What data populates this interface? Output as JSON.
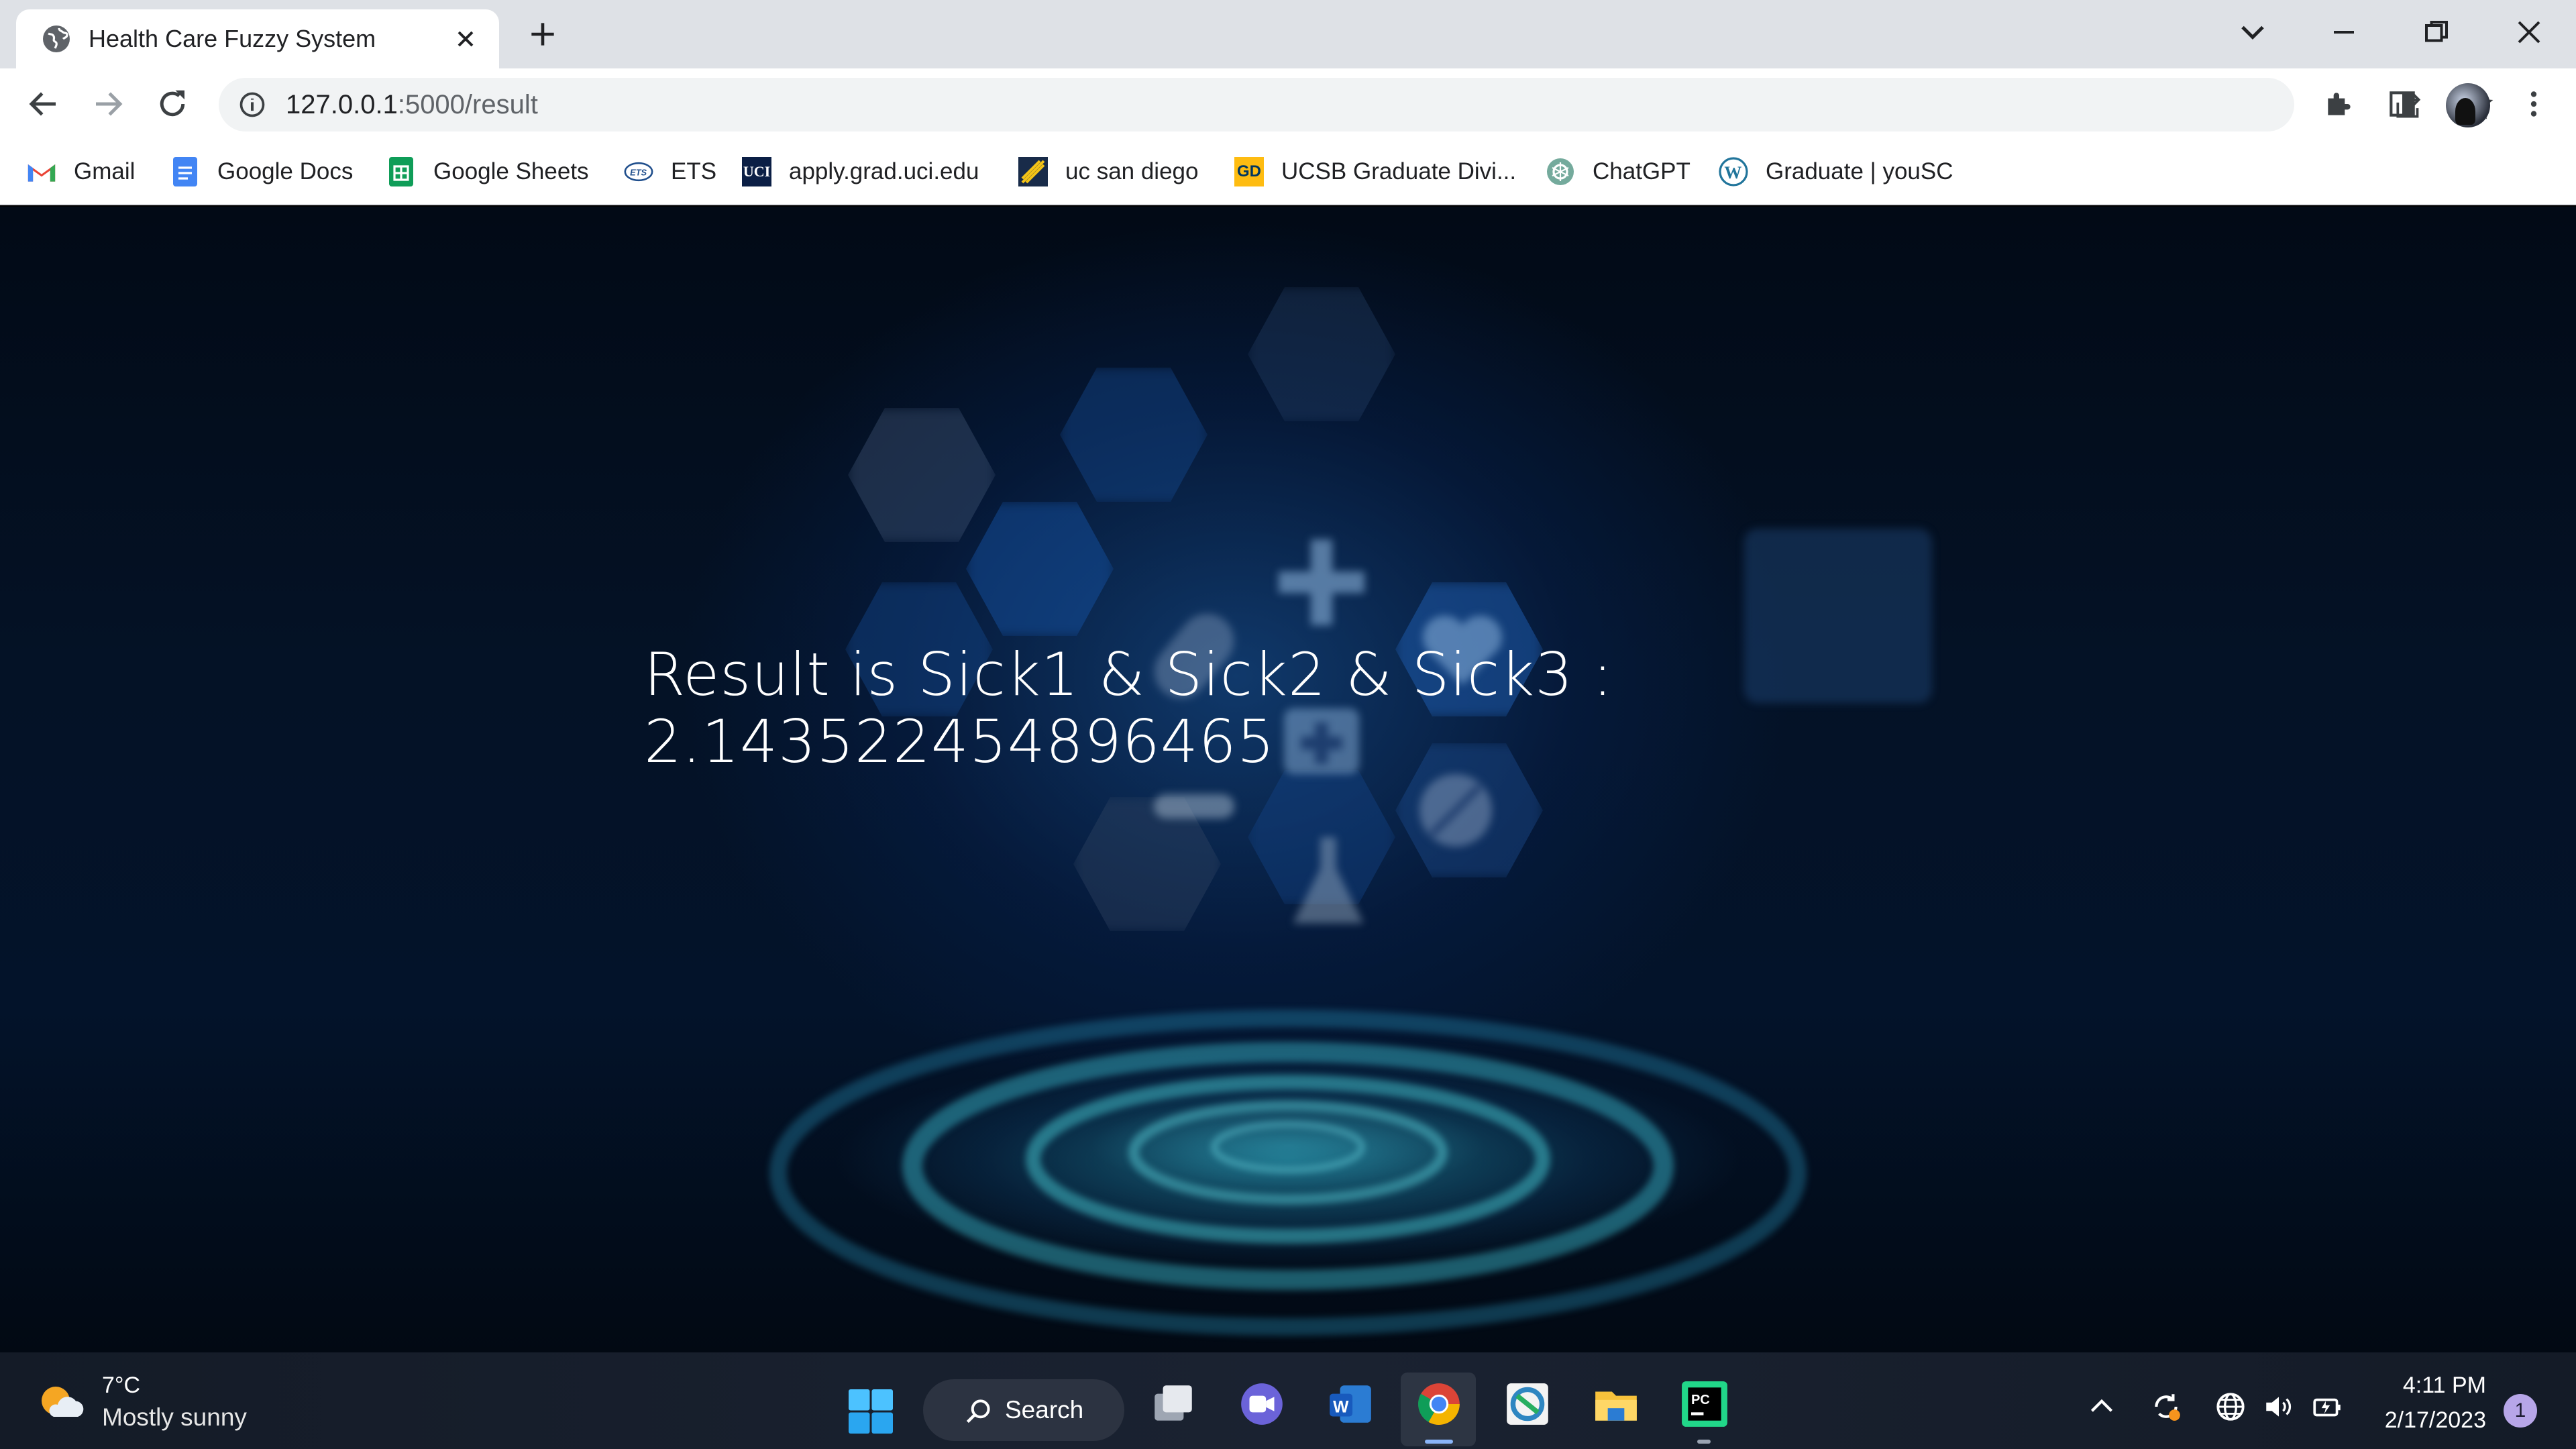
{
  "browser": {
    "tab": {
      "title": "Health Care Fuzzy System"
    },
    "omnibox": {
      "url_host": "127.0.0.1",
      "url_rest": ":5000/result"
    },
    "bookmarks": [
      {
        "label": "Gmail",
        "icon": "gmail-icon"
      },
      {
        "label": "Google Docs",
        "icon": "google-docs-icon"
      },
      {
        "label": "Google Sheets",
        "icon": "google-sheets-icon"
      },
      {
        "label": "ETS",
        "icon": "ets-icon"
      },
      {
        "label": "apply.grad.uci.edu",
        "icon": "uci-icon"
      },
      {
        "label": "uc san diego",
        "icon": "ucsd-icon"
      },
      {
        "label": "UCSB Graduate Divi...",
        "icon": "ucsb-icon"
      },
      {
        "label": "ChatGPT",
        "icon": "chatgpt-icon"
      },
      {
        "label": "Graduate | youSC",
        "icon": "wordpress-icon"
      }
    ]
  },
  "page": {
    "result_line1": "Result is Sick1 & Sick2 & Sick3 :",
    "result_line2": "2.143522454896465"
  },
  "taskbar": {
    "weather": {
      "temp": "7°C",
      "desc": "Mostly sunny"
    },
    "search_label": "Search",
    "clock": {
      "time": "4:11 PM",
      "date": "2/17/2023"
    },
    "notification_count": "1"
  },
  "colors": {
    "chrome_tabstrip": "#dee1e6",
    "page_bg_dark": "#020a16",
    "page_glow": "#28aac8",
    "taskbar_bg": "#1a2231"
  }
}
